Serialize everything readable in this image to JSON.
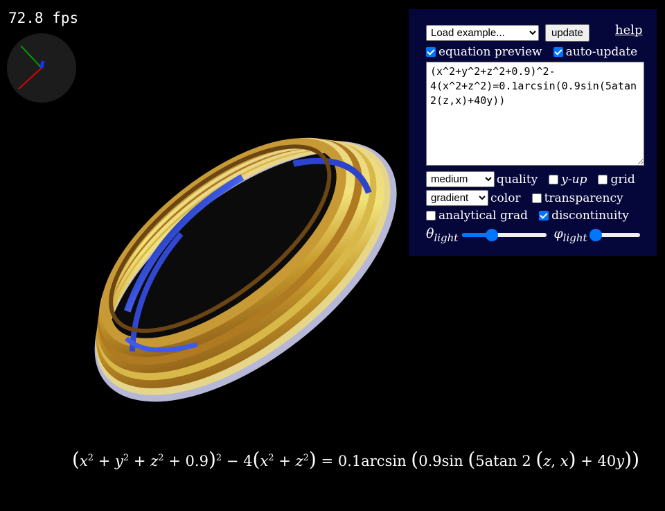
{
  "fps_text": "72.8 fps",
  "panel": {
    "example_select": "Load example...",
    "update_label": "update",
    "help_label": "help",
    "equation_preview_label": "equation preview",
    "auto_update_label": "auto-update",
    "equation_text": "(x^2+y^2+z^2+0.9)^2-4(x^2+z^2)=0.1arcsin(0.9sin(5atan2(z,x)+40y))",
    "quality_select": "medium",
    "quality_label": "quality",
    "y_up_label": "y-up",
    "grid_label": "grid",
    "color_select": "gradient",
    "color_label": "color",
    "transparency_label": "transparency",
    "analytical_grad_label": "analytical grad",
    "discontinuity_label": "discontinuity",
    "theta_label": "θ",
    "phi_label": "φ",
    "light_sub": "light",
    "theta_value": 0.35,
    "phi_value": 0.12,
    "checkboxes": {
      "equation_preview": true,
      "auto_update": true,
      "y_up": false,
      "grid": false,
      "transparency": false,
      "analytical_grad": false,
      "discontinuity": true
    }
  },
  "formula_preview": {
    "x": "x",
    "y": "y",
    "z": "z",
    "two": "2",
    "plus": "+",
    "minus": "−",
    "equals": "=",
    "c09": "0.9",
    "four": "4",
    "coef": "0.1",
    "arcsin": "arcsin",
    "sin": "sin",
    "atan_coef": "5",
    "atan2": "atan 2",
    "comma": ",",
    "forty": "40",
    "lparen": "(",
    "rparen": ")"
  },
  "colors": {
    "panel_bg": "#05063a",
    "accent": "#0075ff",
    "surface_gold": "#d9b84a",
    "surface_blue": "#3b4fd8"
  }
}
